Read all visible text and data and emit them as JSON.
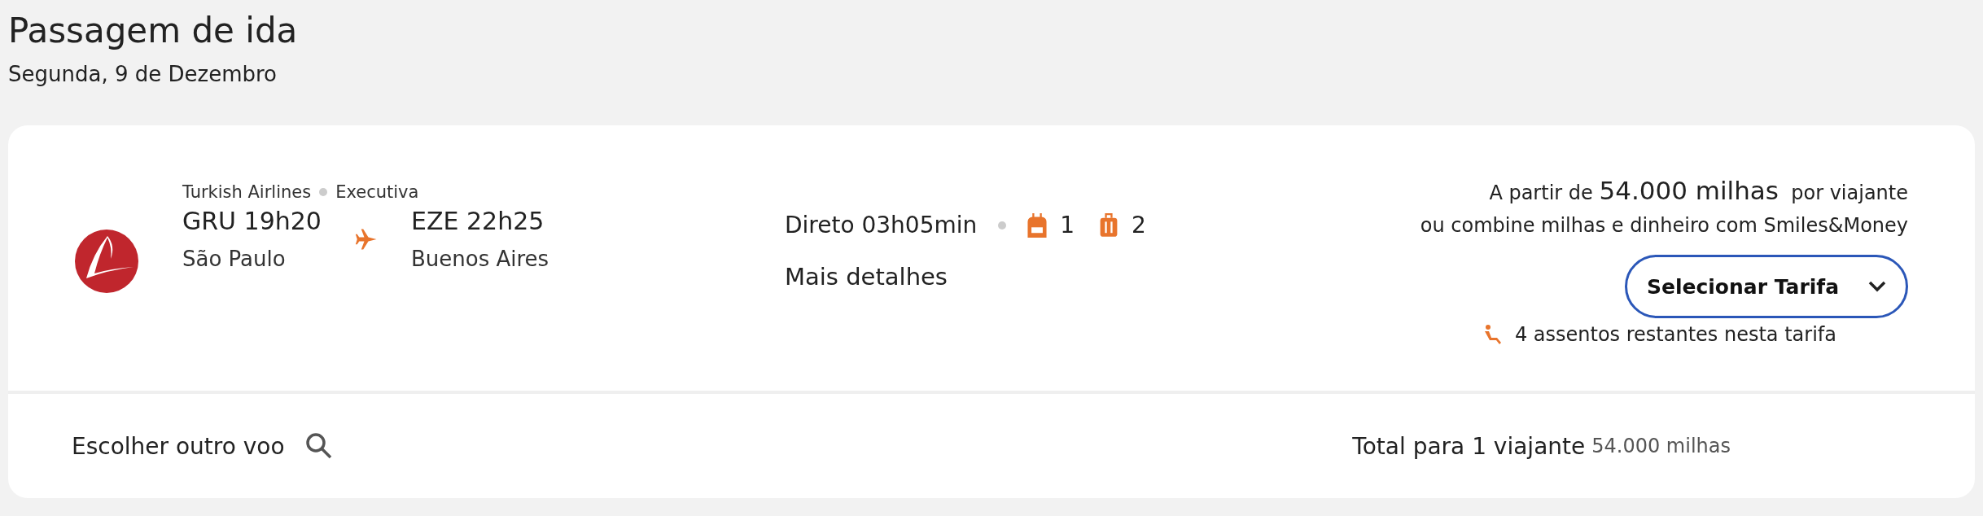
{
  "header": {
    "title": "Passagem de ida",
    "date": "Segunda, 9 de Dezembro"
  },
  "flight": {
    "airline": "Turkish Airlines",
    "cabin": "Executiva",
    "departure": {
      "code_time": "GRU 19h20",
      "city": "São Paulo"
    },
    "arrival": {
      "code_time": "EZE 22h25",
      "city": "Buenos Aires"
    },
    "duration": "Direto 03h05min",
    "carry_on": "1",
    "checked_bags": "2",
    "details_link": "Mais detalhes"
  },
  "price": {
    "line_1": "A partir de **54.000 milhas**  por viajante",
    "line_2": "ou combine milhas e dinheiro com Smiles&Money",
    "button": "Selecionar Tarifa",
    "seats": "4 assentos restantes nesta tarifa"
  },
  "footer": {
    "other_flight": "Escolher outro voo",
    "total_label": "Total para 1 viajante",
    "total_value": "54.000 milhas"
  }
}
